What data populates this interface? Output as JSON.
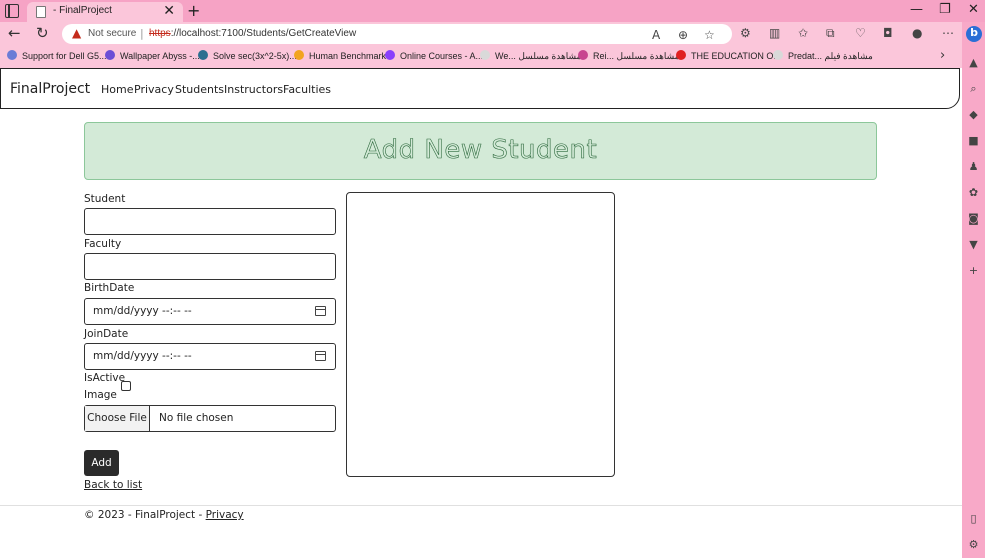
{
  "browser": {
    "tab_title": "- FinalProject",
    "tab_close": "✕",
    "new_tab": "+",
    "window_controls": {
      "minimize": "—",
      "maximize": "❐",
      "close": "✕"
    },
    "security_label": "Not secure",
    "url_scheme": "https",
    "url_rest": "://localhost:7100/Students/GetCreateView",
    "icons": [
      "back-icon",
      "refresh-icon",
      "read-aloud-icon",
      "zoom-icon",
      "favorite-icon",
      "extensions-icon",
      "split-screen-icon",
      "favorites-icon",
      "collections-icon",
      "performance-icon",
      "browser-essentials-icon",
      "profile-icon",
      "more-icon"
    ]
  },
  "bookmarks": [
    {
      "label": "Support for Dell G5...",
      "color": "#6b7cd6"
    },
    {
      "label": "Wallpaper Abyss -...",
      "color": "#6b4ed6"
    },
    {
      "label": "Solve sec(3x^2-5x)...",
      "color": "#2d6f8f"
    },
    {
      "label": "Human Benchmark",
      "color": "#f2a41f"
    },
    {
      "label": "Online Courses - A...",
      "color": "#8a3ffc"
    },
    {
      "label": "We... مشاهدة مسلسل",
      "color": "#d9d9d9"
    },
    {
      "label": "Rei... مشاهدة مسلسل",
      "color": "#c8458f"
    },
    {
      "label": "THE EDUCATION O...",
      "color": "#e02020"
    },
    {
      "label": "Predat... مشاهدة فيلم",
      "color": "#d9d9d9"
    }
  ],
  "bookmarks_more": "›",
  "site": {
    "brand": "FinalProject",
    "nav": [
      "Home",
      "Privacy",
      "Students",
      "Instructors",
      "Faculties"
    ]
  },
  "form": {
    "heading": "Add New Student",
    "student_label": "Student",
    "faculty_label": "Faculty",
    "birthdate_label": "BirthDate",
    "birthdate_value": "mm/dd/yyyy --:-- --",
    "joindate_label": "JoinDate",
    "joindate_value": "mm/dd/yyyy --:-- --",
    "isactive_label": "IsActive",
    "isactive_checked": false,
    "image_label": "Image",
    "file_button": "Choose File",
    "file_status": "No file chosen",
    "submit_label": "Add",
    "back_link": "Back to list"
  },
  "footer": {
    "copyright": "© 2023 - FinalProject -",
    "privacy_link": "Privacy"
  },
  "colors": {
    "browser_chrome": "#f8a9c8",
    "banner_bg": "#d3ead7",
    "banner_text": "#2e6a3e",
    "button_dark": "#2b2b2b",
    "warning": "#c42b1c"
  }
}
